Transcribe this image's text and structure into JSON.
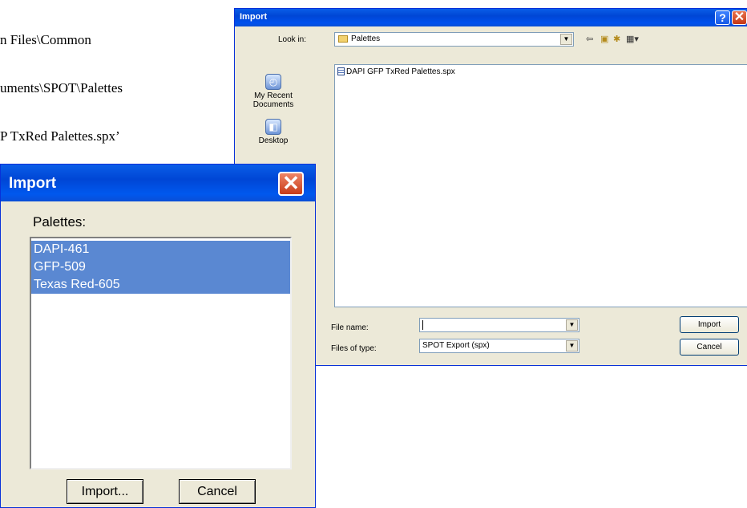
{
  "background": {
    "lines": [
      "n Files\\Common",
      "uments\\SPOT\\Palettes",
      "P TxRed Palettes.spx’"
    ]
  },
  "file_dialog": {
    "title": "Import",
    "help_glyph": "?",
    "close_glyph": "✕",
    "look_in_label": "Look in:",
    "look_in_value": "Palettes",
    "places": [
      {
        "label": "My Recent Documents",
        "icon": "recent-documents-icon"
      },
      {
        "label": "Desktop",
        "icon": "desktop-icon"
      }
    ],
    "files": [
      "DAPI GFP TxRed Palettes.spx"
    ],
    "file_name_label": "File name:",
    "file_name_value": "",
    "files_of_type_label": "Files of type:",
    "files_of_type_value": "SPOT Export (spx)",
    "import_button": "Import",
    "cancel_button": "Cancel"
  },
  "palette_dialog": {
    "title": "Import",
    "close_glyph": "✕",
    "list_label": "Palettes:",
    "palettes": [
      "DAPI-461",
      "GFP-509",
      "Texas Red-605"
    ],
    "import_button": "Import...",
    "cancel_button": "Cancel"
  },
  "colors": {
    "titlebar": "#0046d5",
    "selection": "#5a88d2",
    "dialog_face": "#ece9d8"
  }
}
